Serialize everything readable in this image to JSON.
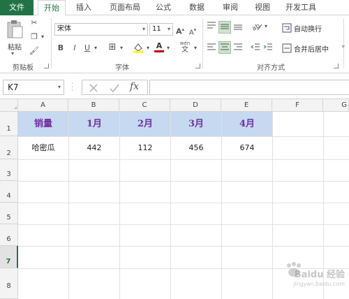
{
  "tabs": [
    {
      "label": "文件"
    },
    {
      "label": "开始"
    },
    {
      "label": "插入"
    },
    {
      "label": "页面布局"
    },
    {
      "label": "公式"
    },
    {
      "label": "数据"
    },
    {
      "label": "审阅"
    },
    {
      "label": "视图"
    },
    {
      "label": "开发工具"
    }
  ],
  "ribbon": {
    "clipboard": {
      "paste_label": "粘贴",
      "group_label": "剪贴板"
    },
    "font": {
      "font_name": "宋体",
      "font_size": "11",
      "bold": "B",
      "italic": "I",
      "underline": "U",
      "group_label": "字体",
      "grow": "A",
      "shrink": "A",
      "font_color": "A",
      "phonetic": "wén"
    },
    "alignment": {
      "wrap_text": "自动换行",
      "merge_center": "合并后居中",
      "group_label": "对齐方式"
    }
  },
  "formula_bar": {
    "name_box": "K7",
    "fx": "fx",
    "formula": ""
  },
  "sheet": {
    "columns": [
      "A",
      "B",
      "C",
      "D",
      "E",
      "F",
      "G"
    ],
    "rows": [
      "1",
      "2",
      "3",
      "4",
      "5",
      "6",
      "7",
      "8"
    ],
    "row1": [
      "销量",
      "1月",
      "2月",
      "3月",
      "4月"
    ],
    "row2": [
      "哈密瓜",
      "442",
      "112",
      "456",
      "674"
    ],
    "active_row": "7"
  },
  "colors": {
    "accent": "#217346",
    "header_fill": "#c6d9f0",
    "header_text": "#7030a0"
  },
  "watermark": {
    "text": "Baidu 经验",
    "subtext": "jingyan.baidu.com"
  }
}
